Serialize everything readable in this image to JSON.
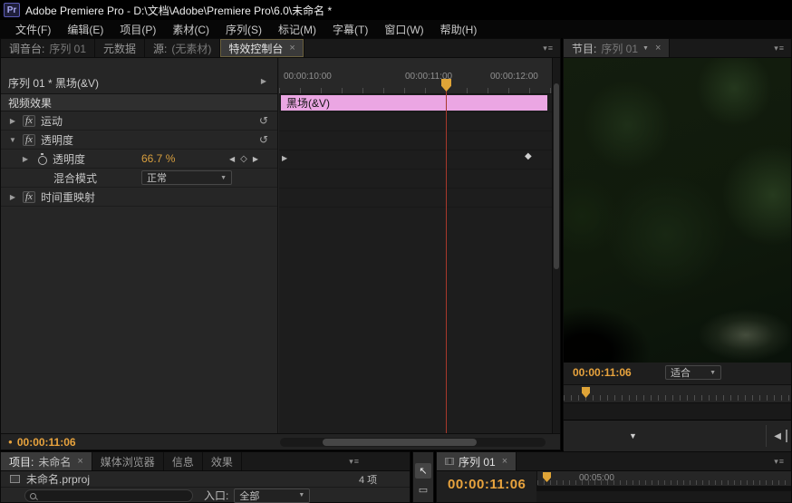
{
  "title_bar": {
    "app_initials": "Pr",
    "title": "Adobe Premiere Pro - D:\\文档\\Adobe\\Premiere Pro\\6.0\\未命名 *"
  },
  "menu": {
    "items": [
      "文件(F)",
      "编辑(E)",
      "项目(P)",
      "素材(C)",
      "序列(S)",
      "标记(M)",
      "字幕(T)",
      "窗口(W)",
      "帮助(H)"
    ]
  },
  "effect_controls": {
    "tab_mixer_label": "调音台:",
    "tab_mixer_doc": "序列 01",
    "tab_metadata": "元数据",
    "tab_source_label": "源:",
    "tab_source_doc": "(无素材)",
    "tab_effects": "特效控制台",
    "clip_title": "序列 01 * 黑场(&V)",
    "ruler_ticks": [
      "00:00:10:00",
      "00:00:11:00",
      "00:00:12:00"
    ],
    "section_video_effects": "视频效果",
    "clip_label": "黑场(&V)",
    "row_motion": "运动",
    "row_opacity": "透明度",
    "param_opacity": "透明度",
    "opacity_value": "66.7 %",
    "row_blend_label": "混合模式",
    "blend_value": "正常",
    "row_time_remap": "时间重映射",
    "footer_timecode": "00:00:11:06"
  },
  "program_monitor": {
    "tab_label": "节目:",
    "tab_doc": "序列 01",
    "timecode": "00:00:11:06",
    "zoom_fit": "适合"
  },
  "project_panel": {
    "tab_project_label": "项目:",
    "tab_project_doc": "未命名",
    "tab_media_browser": "媒体浏览器",
    "tab_info": "信息",
    "tab_effects": "效果",
    "file_name": "未命名.prproj",
    "item_count": "4 项",
    "filter_label": "入口:",
    "filter_value": "全部"
  },
  "timeline": {
    "tab": "序列 01",
    "timecode": "00:00:11:06",
    "ruler_label": "00:05:00"
  },
  "icons": {
    "panel_menu": "▾≡",
    "close": "×",
    "expand": "▶",
    "collapse": "▼",
    "reset": "↺",
    "prev_keyframe": "◀",
    "add_keyframe": "◇",
    "next_keyframe": "▶",
    "keyframe": "◆",
    "dropdown": "▼",
    "play_dot": "●",
    "fx": "fx",
    "selection_tool": "↖",
    "track_select_tool": "▭",
    "transport_dropdown": "▼",
    "transport_back": "◀"
  },
  "colors": {
    "accent_orange": "#e8a33d",
    "clip_pink": "#eba6e3",
    "playhead_red": "#a8392c"
  }
}
